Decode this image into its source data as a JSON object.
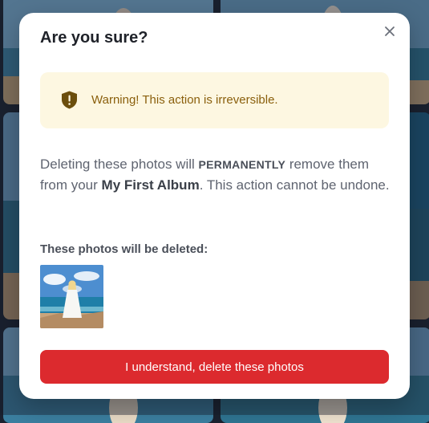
{
  "modal": {
    "title": "Are you sure?",
    "close_icon": "close-icon",
    "warning": {
      "icon": "shield-warning-icon",
      "text": "Warning! This action is irreversible."
    },
    "message": {
      "part1": "Deleting these photos will ",
      "emphasis": "PERMANENTLY",
      "part2": " remove them from your ",
      "album_name": "My First Album",
      "part3": ". This action cannot be undone."
    },
    "list_label": "These photos will be deleted:",
    "confirm_label": "I understand, delete these photos"
  },
  "colors": {
    "danger": "#dc2a2e",
    "warning_bg": "#fdf7e1",
    "warning_text": "#8a5f0c"
  }
}
